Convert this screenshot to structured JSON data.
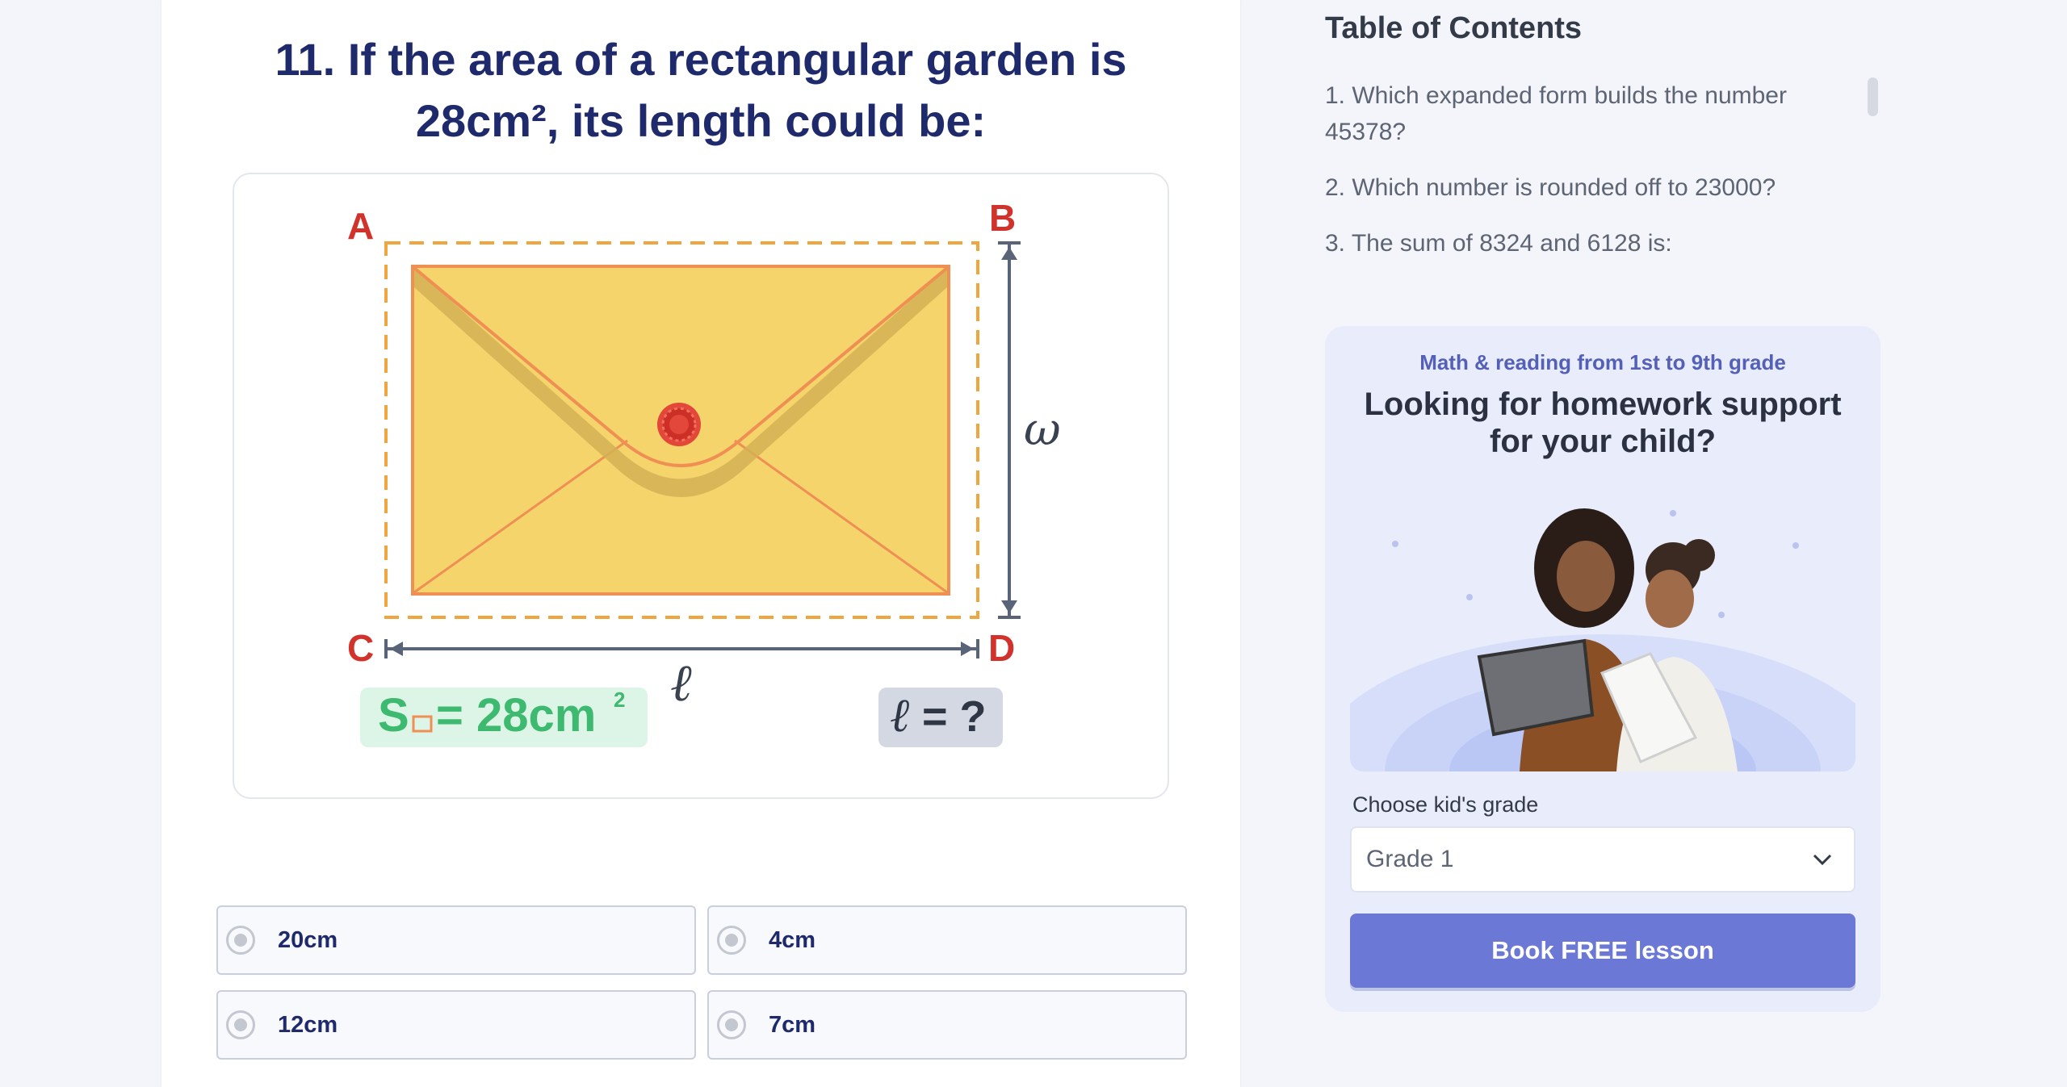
{
  "question": {
    "title_line1": "11. If the area of a rectangular garden is",
    "title_line2": "28cm², its length could be:"
  },
  "figure": {
    "corner_a": "A",
    "corner_b": "B",
    "corner_c": "C",
    "corner_d": "D",
    "width_symbol": "ω",
    "length_symbol": "ℓ",
    "area_label": "S",
    "area_value": "= 28cm",
    "area_exponent": "2",
    "unknown_symbol": "ℓ",
    "unknown_rest": "= ?"
  },
  "answers": [
    {
      "label": "20cm"
    },
    {
      "label": "4cm"
    },
    {
      "label": "12cm"
    },
    {
      "label": "7cm"
    }
  ],
  "toc": {
    "title": "Table of Contents",
    "items": [
      "1. Which expanded form builds the number 45378?",
      "2. Which number is rounded off to 23000?",
      "3. The sum of 8324 and 6128 is:"
    ]
  },
  "promo": {
    "subtitle": "Math & reading from 1st to 9th grade",
    "title_line1": "Looking for homework support",
    "title_line2": "for your child?",
    "grade_label": "Choose kid's grade",
    "grade_value": "Grade 1",
    "cta": "Book FREE lesson"
  },
  "colors": {
    "title": "#1e2a6b",
    "envelope": "#f4d46b",
    "envelope_stroke": "#ef8f54",
    "dashed": "#f0a640",
    "corner_labels": "#d2322c",
    "area_badge": "#dcf5e7",
    "area_text": "#3dba6f",
    "unknown_badge": "#d3d8e2",
    "cta": "#6b78d6"
  }
}
